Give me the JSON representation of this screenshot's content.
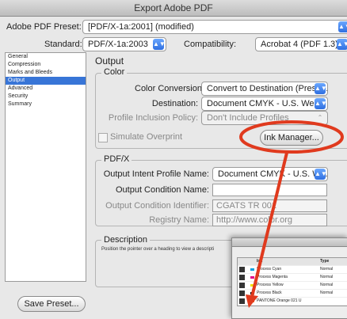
{
  "window": {
    "title": "Export Adobe PDF"
  },
  "header": {
    "preset_label": "Adobe PDF Preset:",
    "preset_value": "[PDF/X-1a:2001] (modified)",
    "standard_label": "Standard:",
    "standard_value": "PDF/X-1a:2003",
    "compat_label": "Compatibility:",
    "compat_value": "Acrobat 4 (PDF 1.3)"
  },
  "sidebar": {
    "items": [
      "General",
      "Compression",
      "Marks and Bleeds",
      "Output",
      "Advanced",
      "Security",
      "Summary"
    ]
  },
  "output": {
    "heading": "Output",
    "color": {
      "title": "Color",
      "conversion_label": "Color Conversion:",
      "conversion_value": "Convert to Destination (Prese...",
      "destination_label": "Destination:",
      "destination_value": "Document CMYK - U.S. Web...",
      "profile_label": "Profile Inclusion Policy:",
      "profile_value": "Don't Include Profiles",
      "simulate_label": "Simulate Overprint",
      "ink_manager_label": "Ink Manager..."
    },
    "pdfx": {
      "title": "PDF/X",
      "intent_label": "Output Intent Profile Name:",
      "intent_value": "Document CMYK - U.S. We...",
      "condition_name_label": "Output Condition Name:",
      "condition_name_value": "",
      "condition_id_label": "Output Condition Identifier:",
      "condition_id_value": "CGATS TR 001",
      "registry_label": "Registry Name:",
      "registry_value": "http://www.color.org"
    },
    "description": {
      "title": "Description",
      "text": "Position the pointer over a heading to view a descripti"
    }
  },
  "footer": {
    "save_preset_label": "Save Preset..."
  },
  "ink_manager": {
    "col_ink": "Ink",
    "col_type": "Type",
    "rows": [
      {
        "name": "Process Cyan",
        "type": "Normal",
        "color": "#00a0e0"
      },
      {
        "name": "Process Magenta",
        "type": "Normal",
        "color": "#e0008a"
      },
      {
        "name": "Process Yellow",
        "type": "Normal",
        "color": "#f2e000"
      },
      {
        "name": "Process Black",
        "type": "Normal",
        "color": "#111111"
      },
      {
        "name": "PANTONE Orange 021 U",
        "type": "",
        "color": "#ff6a13"
      }
    ]
  },
  "annotation": {
    "color": "#e03a1e"
  }
}
